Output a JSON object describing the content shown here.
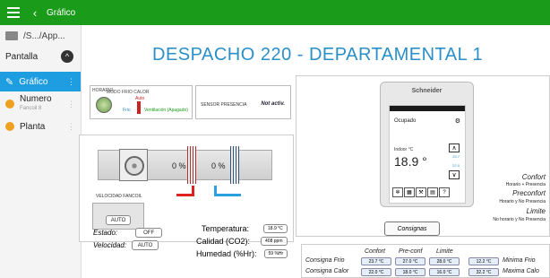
{
  "topbar": {
    "title": "Gráfico"
  },
  "sidebar": {
    "path": "/S.../App...",
    "pantalla": "Pantalla",
    "items": [
      {
        "label": "Gráfico"
      },
      {
        "label": "Numero",
        "sub": "Fancoil 8"
      },
      {
        "label": "Planta"
      }
    ]
  },
  "page_title": "DESPACHO 220 - DEPARTAMENTAL 1",
  "mode_panel": {
    "horario": "HORARIO",
    "modo": "MODO FRIO CALOR",
    "auto": "Auto",
    "frio": "Frio",
    "vent": "Ventilación (Apagado)"
  },
  "presence": {
    "label": "SENSOR PRESENCIA",
    "value": "Not activ."
  },
  "fancoil": {
    "pct_left": "0 %",
    "pct_right": "0 %",
    "velocity_label": "VELOCIDAD FANCOIL",
    "auto_btn": "AUTO"
  },
  "status": {
    "estado_label": "Estado:",
    "estado_value": "OFF",
    "velocidad_label": "Velocidad:",
    "velocidad_value": "AUTO",
    "temp_label": "Temperatura:",
    "temp_value": "18.9 °C",
    "co2_label": "Calidad (CO2):",
    "co2_value": "408 ppm",
    "hum_label": "Humedad (%Hr):",
    "hum_value": "59 %Hr"
  },
  "thermostat": {
    "brand": "Schneider",
    "status": "Ocupado",
    "indoor_label": "Indoor °C",
    "temp": "18.9 °",
    "sp_high": "23.7",
    "sp_low": "22.0",
    "consignas_btn": "Consignas"
  },
  "legend": {
    "confort": "Confort",
    "confort_sub": "Horario + Presencia",
    "preconfort": "Preconfort",
    "preconfort_sub": "Horario y No Presencia",
    "limite": "Limite",
    "limite_sub": "No horario y No Presencia"
  },
  "consignas_table": {
    "headers": [
      "Confort",
      "Pre-conf",
      "Limite"
    ],
    "frio_label": "Consigna Frio",
    "frio_values": [
      "23.7 °C",
      "27.0 °C",
      "28.0 °C"
    ],
    "calor_label": "Consigna Calor",
    "calor_values": [
      "22.0 °C",
      "18.0 °C",
      "16.0 °C"
    ],
    "min_frio_value": "12.2 °C",
    "min_frio_label": "Minima Frio",
    "max_calor_value": "32.2 °C",
    "max_calor_label": "Maxima Calo"
  }
}
